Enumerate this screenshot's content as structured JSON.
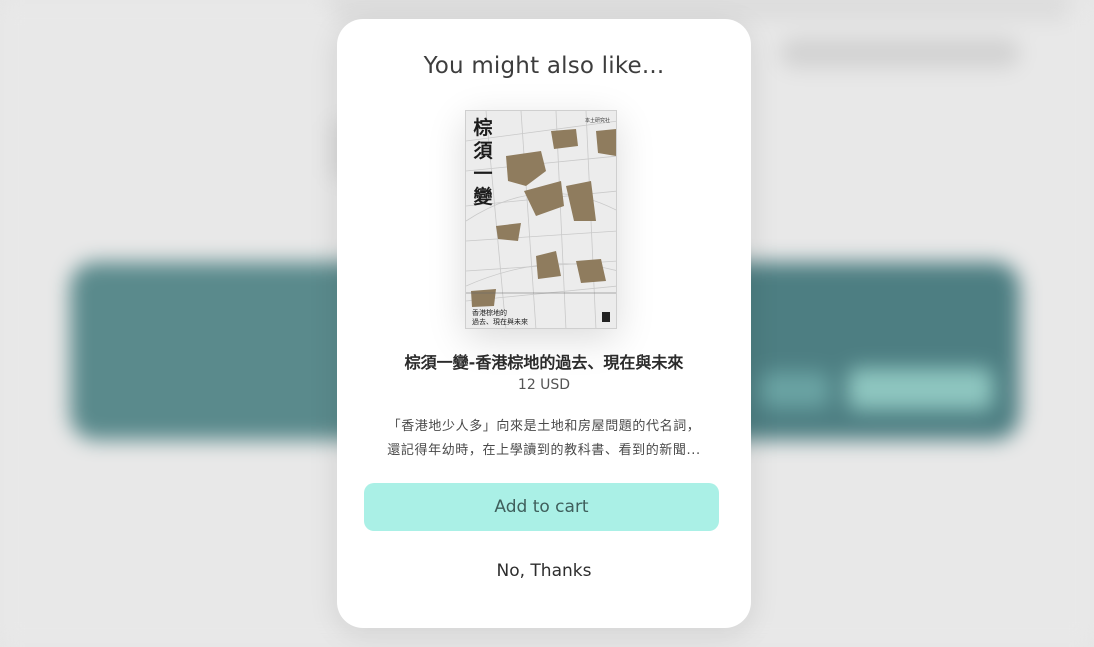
{
  "modal": {
    "title": "You might also like...",
    "product": {
      "name": "棕須一變-香港棕地的過去、現在與未來",
      "price": "12 USD",
      "description_line1": "「香港地少人多」向來是土地和房屋問題的代名詞，",
      "description_line2": "還記得年幼時，在上學讀到的教科書、看到的新聞...",
      "cover": {
        "title": "棕須一變",
        "subtitle_line1": "香港棕地的",
        "subtitle_line2": "過去、現在與未來",
        "publisher": "本土研究社"
      }
    },
    "add_to_cart_label": "Add to cart",
    "dismiss_label": "No, Thanks"
  },
  "colors": {
    "accent_button": "#aaf0e6",
    "backdrop_banner": "#4d7e82"
  }
}
